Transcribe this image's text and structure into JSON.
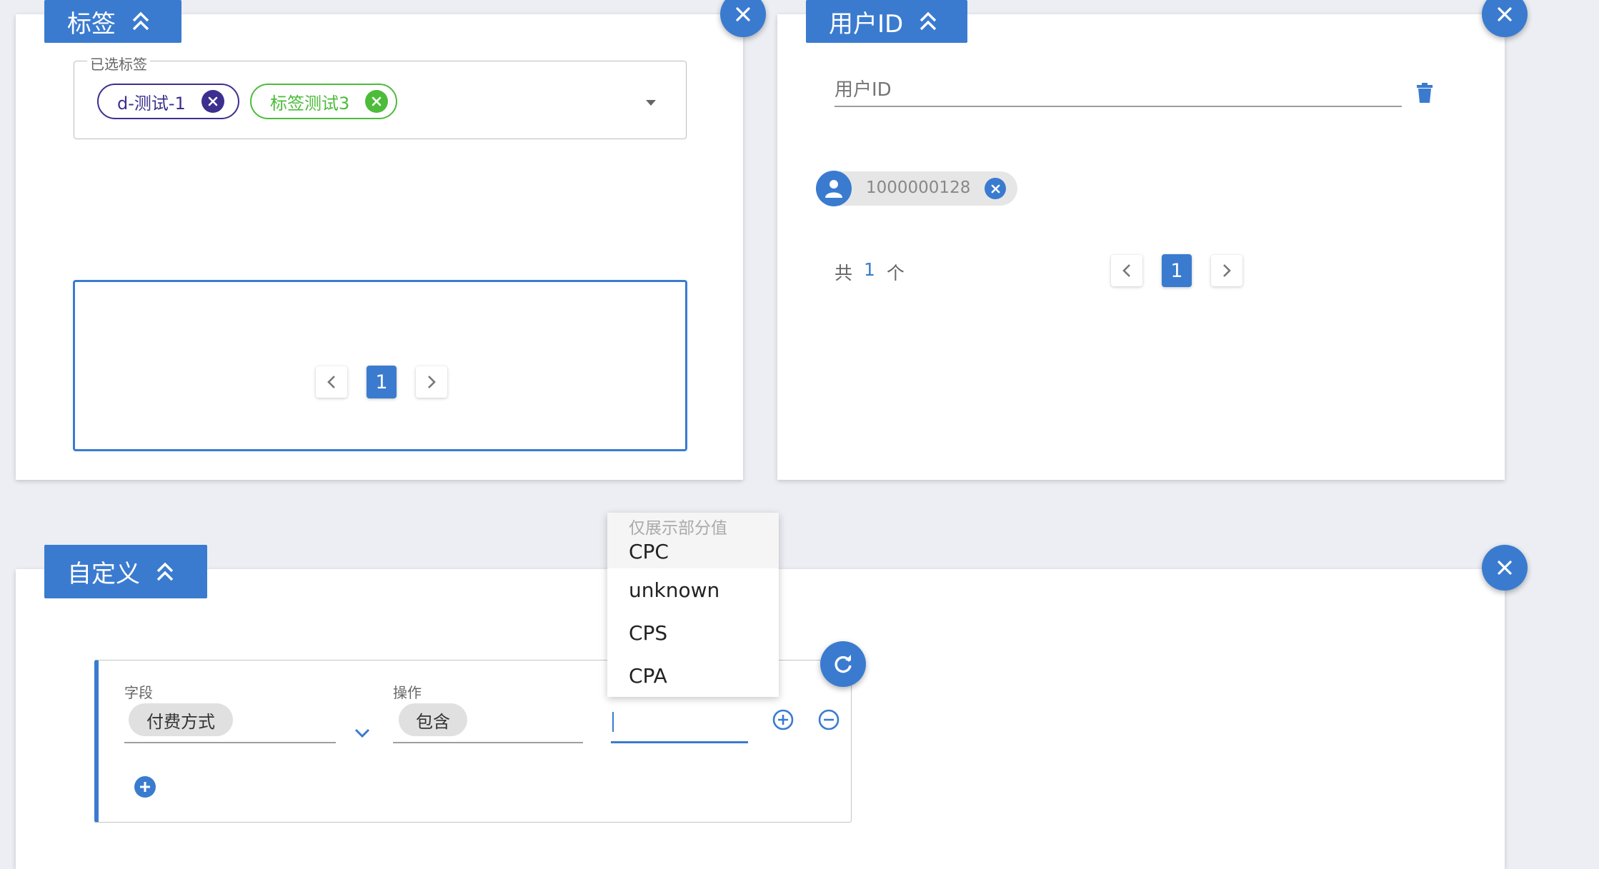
{
  "tags_panel": {
    "title": "标签",
    "selected_label": "已选标签",
    "chips": [
      {
        "label": "d-测试-1",
        "color": "#3b2f8f"
      },
      {
        "label": "标签测试3",
        "color": "#4cbc3a"
      }
    ],
    "page": "1"
  },
  "userid_panel": {
    "title": "用户ID",
    "placeholder": "用户ID",
    "chip_value": "1000000128",
    "total_prefix": "共",
    "total_count": "1",
    "total_suffix": "个",
    "page": "1"
  },
  "custom_panel": {
    "title": "自定义",
    "field_label": "字段",
    "field_value": "付费方式",
    "op_label": "操作",
    "op_value": "包含",
    "value_input": ""
  },
  "dropdown": {
    "hint": "仅展示部分值",
    "options": [
      "CPC",
      "unknown",
      "CPS",
      "CPA"
    ]
  },
  "colors": {
    "accent": "#3a7bd0",
    "background": "#eceef3"
  }
}
